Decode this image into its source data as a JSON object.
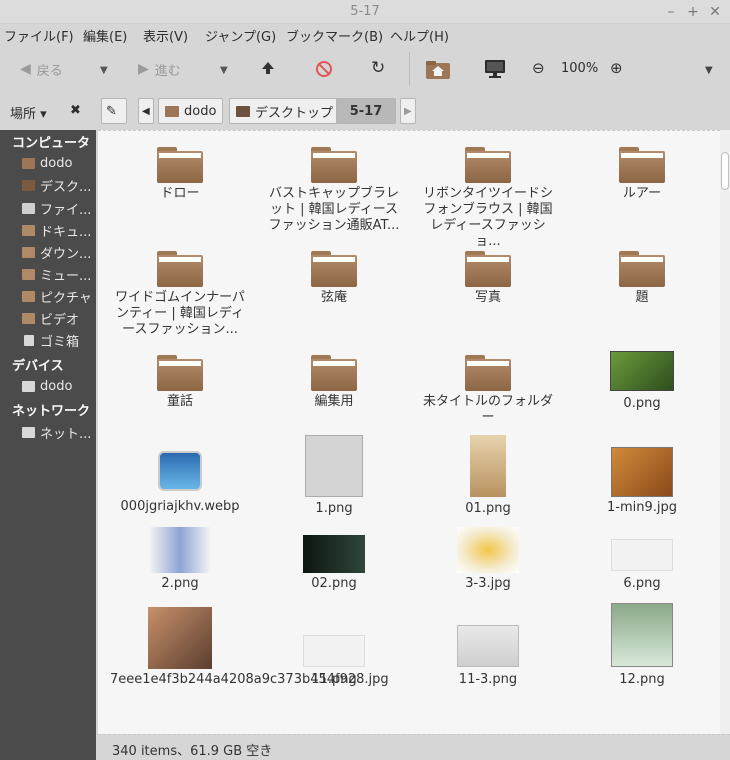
{
  "window": {
    "title": "5-17"
  },
  "menu": [
    "ファイル(F)",
    "編集(E)",
    "表示(V)",
    "ジャンプ(G)",
    "ブックマーク(B)",
    "ヘルプ(H)"
  ],
  "toolbar": {
    "back_label": "戻る",
    "forward_label": "進む",
    "zoom_label": "100%"
  },
  "places": {
    "label": "場所 ▾",
    "close": "✖"
  },
  "path": [
    "dodo",
    "デスクトップ",
    "5-17"
  ],
  "sidebar": {
    "computer_header": "コンピュータ",
    "computer_items": [
      {
        "label": "dodo",
        "icon": "home-folder-icon"
      },
      {
        "label": "デスク...",
        "icon": "desktop-icon"
      },
      {
        "label": "ファイ...",
        "icon": "filesystem-icon"
      },
      {
        "label": "ドキュ...",
        "icon": "documents-icon"
      },
      {
        "label": "ダウン...",
        "icon": "downloads-icon"
      },
      {
        "label": "ミュー...",
        "icon": "music-icon"
      },
      {
        "label": "ピクチャ",
        "icon": "pictures-icon"
      },
      {
        "label": "ビデオ",
        "icon": "videos-icon"
      },
      {
        "label": "ゴミ箱",
        "icon": "trash-icon"
      }
    ],
    "devices_header": "デバイス",
    "devices_items": [
      {
        "label": "dodo",
        "icon": "drive-icon"
      }
    ],
    "network_header": "ネットワーク",
    "network_items": [
      {
        "label": "ネット...",
        "icon": "network-icon"
      }
    ]
  },
  "files": [
    {
      "name": "ドロー",
      "type": "folder"
    },
    {
      "name": "バストキャップブラレット | 韓国レディースファッション通販AT...",
      "type": "folder"
    },
    {
      "name": "リボンタイツイードシフォンブラウス | 韓国レディースファッショ...",
      "type": "folder"
    },
    {
      "name": "ルアー",
      "type": "folder"
    },
    {
      "name": "ワイドゴムインナーパンティー | 韓国レディースファッション...",
      "type": "folder"
    },
    {
      "name": "弦庵",
      "type": "folder"
    },
    {
      "name": "写真",
      "type": "folder"
    },
    {
      "name": "題",
      "type": "folder"
    },
    {
      "name": "童話",
      "type": "folder"
    },
    {
      "name": "編集用",
      "type": "folder"
    },
    {
      "name": "未タイトルのフォルダー",
      "type": "folder"
    },
    {
      "name": "0.png",
      "type": "image",
      "color": "#3f6e2a"
    },
    {
      "name": "000jgriajkhv.webp",
      "type": "webp"
    },
    {
      "name": "1.png",
      "type": "image",
      "color": "#c9c9c9"
    },
    {
      "name": "01.png",
      "type": "image",
      "color": "#d9b98a"
    },
    {
      "name": "1-min9.jpg",
      "type": "image",
      "color": "#b86a2a"
    },
    {
      "name": "2.png",
      "type": "image",
      "color": "#8a9cc8"
    },
    {
      "name": "02.png",
      "type": "image",
      "color": "#1c2a22"
    },
    {
      "name": "3-3.jpg",
      "type": "image",
      "color": "#e9d7a6"
    },
    {
      "name": "6.png",
      "type": "image",
      "color": "#f0f0f0"
    },
    {
      "name": "7eee1e4f3b244a4208a9c373b454f928.jpg",
      "type": "image",
      "color": "#a47a5e"
    },
    {
      "name": "11.png",
      "type": "image",
      "color": "#eeeeee"
    },
    {
      "name": "11-3.png",
      "type": "image",
      "color": "#e4e4e4"
    },
    {
      "name": "12.png",
      "type": "image",
      "color": "#7a9a7a"
    }
  ],
  "status": {
    "text": "340 items、61.9 GB 空き"
  },
  "colors": {
    "sidebar_bg": "#4b4b4b",
    "folder": "#9c7656",
    "window_bg": "#d6d6d6"
  }
}
